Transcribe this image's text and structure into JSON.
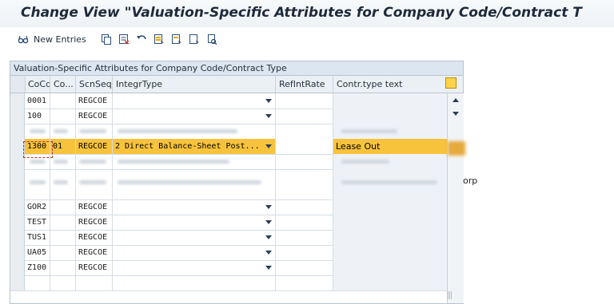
{
  "window": {
    "title": "Change View \"Valuation-Specific Attributes for Company Code/Contract T"
  },
  "toolbar": {
    "new_entries_label": "New Entries",
    "icons": [
      "glasses-icon",
      "copy-icon",
      "delete-icon",
      "undo-icon",
      "select-all-icon",
      "select-block-icon",
      "deselect-all-icon",
      "print-icon"
    ]
  },
  "table": {
    "title": "Valuation-Specific Attributes for Company Code/Contract Type",
    "columns": [
      "CoCd",
      "Co...",
      "ScnSeq",
      "IntegrType",
      "RefIntRate",
      "Contr.type text"
    ],
    "rows": [
      {
        "cocd": "0001",
        "co": "",
        "scnseq": "REGCOE",
        "integrtype": "",
        "refintrate": "",
        "contrtext": ""
      },
      {
        "cocd": "100",
        "co": "",
        "scnseq": "REGCOE",
        "integrtype": "",
        "refintrate": "",
        "contrtext": ""
      },
      {
        "cocd": "",
        "co": "",
        "scnseq": "",
        "integrtype": "",
        "refintrate": "",
        "contrtext": ""
      },
      {
        "cocd": "1300",
        "co": "01",
        "scnseq": "REGCOE",
        "integrtype": "2 Direct Balance-Sheet Post...",
        "refintrate": "",
        "contrtext": "Lease Out"
      },
      {
        "cocd": "",
        "co": "",
        "scnseq": "",
        "integrtype": "",
        "refintrate": "",
        "contrtext": ""
      },
      {
        "cocd": "",
        "co": "",
        "scnseq": "",
        "integrtype": "",
        "refintrate": "",
        "contrtext": ""
      },
      {
        "cocd": "",
        "co": "",
        "scnseq": "",
        "integrtype": "",
        "refintrate": "",
        "contrtext": ""
      },
      {
        "cocd": "GOR2",
        "co": "",
        "scnseq": "REGCOE",
        "integrtype": "",
        "refintrate": "",
        "contrtext": ""
      },
      {
        "cocd": "TEST",
        "co": "",
        "scnseq": "REGCOE",
        "integrtype": "",
        "refintrate": "",
        "contrtext": ""
      },
      {
        "cocd": "TUS1",
        "co": "",
        "scnseq": "REGCOE",
        "integrtype": "",
        "refintrate": "",
        "contrtext": ""
      },
      {
        "cocd": "UA05",
        "co": "",
        "scnseq": "REGCOE",
        "integrtype": "",
        "refintrate": "",
        "contrtext": ""
      },
      {
        "cocd": "Z100",
        "co": "",
        "scnseq": "REGCOE",
        "integrtype": "",
        "refintrate": "",
        "contrtext": ""
      },
      {
        "cocd": "",
        "co": "",
        "scnseq": "",
        "integrtype": "",
        "refintrate": "",
        "contrtext": ""
      }
    ],
    "side_text": "orp"
  }
}
